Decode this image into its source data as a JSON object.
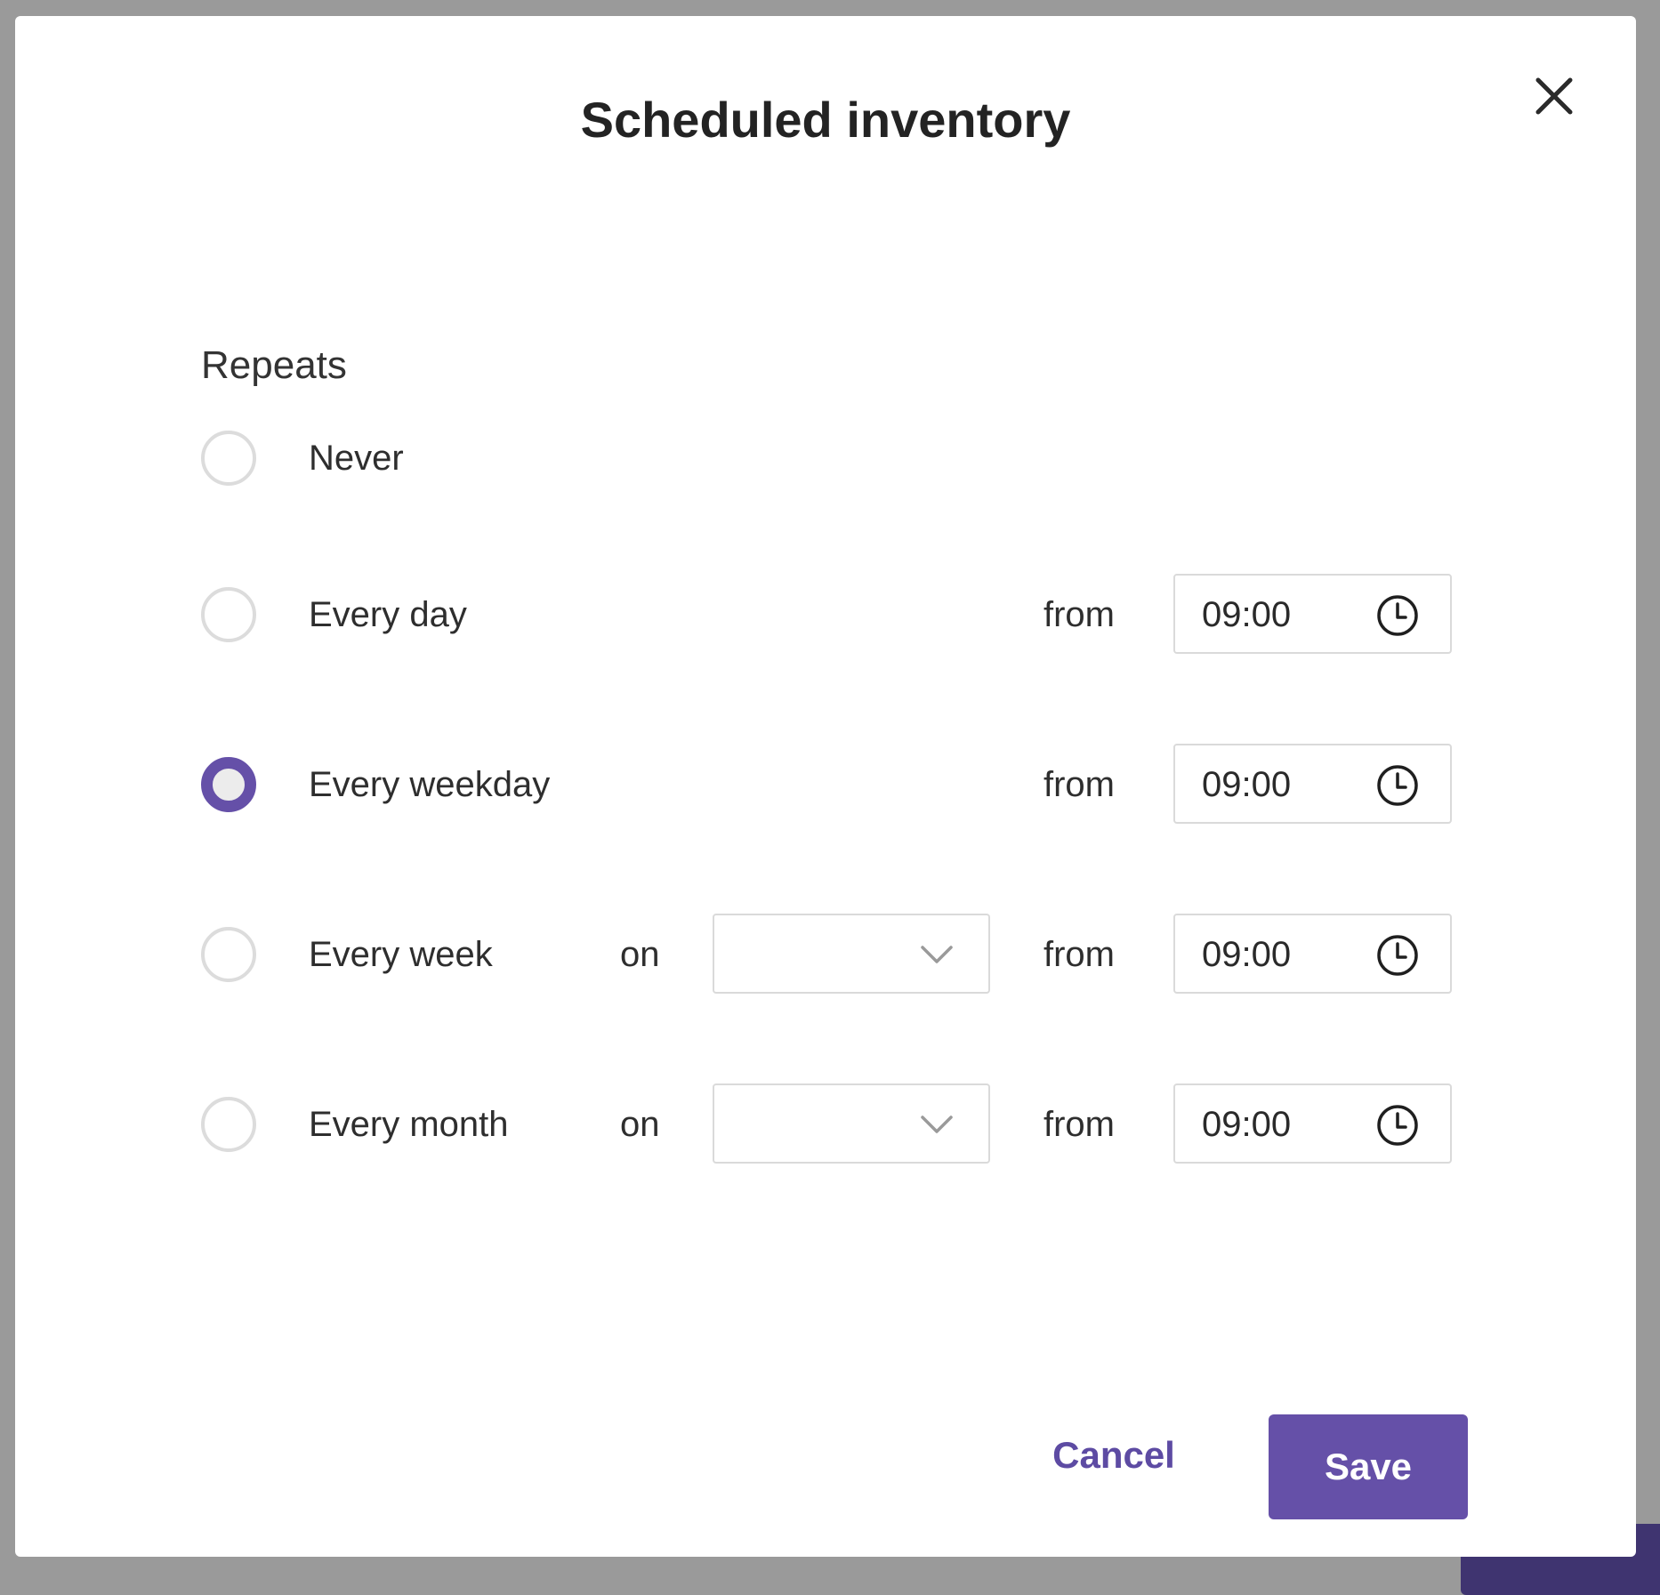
{
  "modal": {
    "title": "Scheduled inventory",
    "section_label": "Repeats"
  },
  "options": [
    {
      "label": "Never",
      "checked": false
    },
    {
      "label": "Every day",
      "checked": false,
      "from_label": "from",
      "time": "09:00"
    },
    {
      "label": "Every weekday",
      "checked": true,
      "from_label": "from",
      "time": "09:00"
    },
    {
      "label": "Every week",
      "checked": false,
      "on_label": "on",
      "select_value": "",
      "from_label": "from",
      "time": "09:00"
    },
    {
      "label": "Every month",
      "checked": false,
      "on_label": "on",
      "select_value": "",
      "from_label": "from",
      "time": "09:00"
    }
  ],
  "footer": {
    "cancel_label": "Cancel",
    "save_label": "Save"
  },
  "colors": {
    "accent": "#6550a8",
    "backdrop": "#9a9a9a"
  }
}
